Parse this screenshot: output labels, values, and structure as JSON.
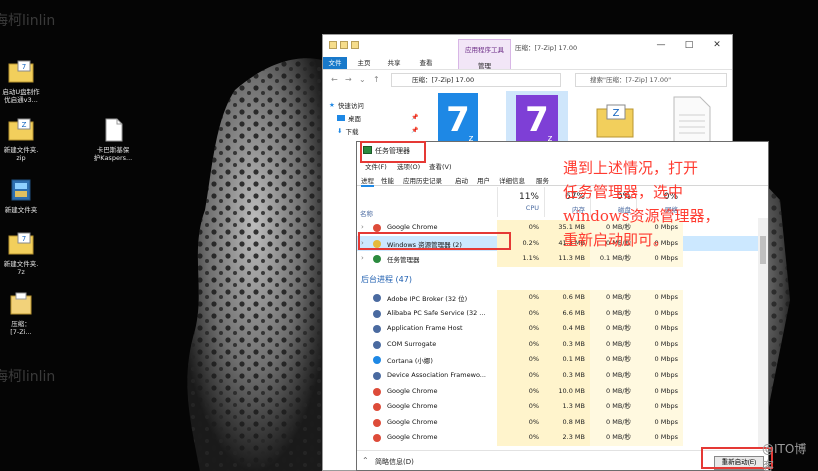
{
  "desktop": {
    "watermarks": [
      "海柯linlin",
      "海柯linlin"
    ],
    "corner_watermark": "@ITO博客",
    "icons": [
      {
        "label": "启动U盘制作\n优启通v3...",
        "icon": "7zip-archive-icon"
      },
      {
        "label": "新建文件夹.\nzip",
        "icon": "zip-archive-icon"
      },
      {
        "label": "卡巴斯基保\n护Kaspers...",
        "icon": "document-icon"
      },
      {
        "label": "新建文件夹",
        "icon": "folder-icon"
      },
      {
        "label": "新建文件夹.\n7z",
        "icon": "7zip-archive-icon"
      },
      {
        "label": "压缩：\n[7-Zi...",
        "icon": "folder-icon"
      }
    ]
  },
  "explorer": {
    "context_tab_top": "应用程序工具",
    "context_tab_bottom": "管理",
    "title": "压缩：[7-Zip] 17.00",
    "ribbon_tabs": [
      "文件",
      "主页",
      "共享",
      "查看"
    ],
    "address": "压缩：[7-Zip] 17.00",
    "search_placeholder": "搜索\"压缩：[7-Zip] 17.00\"",
    "nav_items": [
      "快速访问",
      "桌面",
      "下载"
    ],
    "window_buttons": [
      "—",
      "□",
      "✕"
    ],
    "zip_letter": "Z",
    "seven": "7"
  },
  "taskmgr": {
    "title": "任务管理器",
    "menu": [
      "文件(F)",
      "选项(O)",
      "查看(V)"
    ],
    "tabs": [
      "进程",
      "性能",
      "应用历史记录",
      "启动",
      "用户",
      "详细信息",
      "服务"
    ],
    "columns": [
      {
        "pct": "11%",
        "name": "CPU"
      },
      {
        "pct": "67%",
        "name": "内存"
      },
      {
        "pct": "0%",
        "name": "磁盘"
      },
      {
        "pct": "0%",
        "name": "网络"
      }
    ],
    "name_header": "名称",
    "background_section": "后台进程 (47)",
    "apps": [
      {
        "name": "Google Chrome",
        "cpu": "0%",
        "mem": "35.1 MB",
        "disk": "0 MB/秒",
        "net": "0 Mbps",
        "icon": "chrome-icon"
      },
      {
        "name": "Windows 资源管理器 (2)",
        "cpu": "0.2%",
        "mem": "41.3 MB",
        "disk": "0 MB/秒",
        "net": "0 Mbps",
        "icon": "explorer-icon"
      },
      {
        "name": "任务管理器",
        "cpu": "1.1%",
        "mem": "11.3 MB",
        "disk": "0.1 MB/秒",
        "net": "0 Mbps",
        "icon": "taskmgr-icon"
      }
    ],
    "background": [
      {
        "name": "Adobe IPC Broker (32 位)",
        "cpu": "0%",
        "mem": "0.6 MB",
        "disk": "0 MB/秒",
        "net": "0 Mbps",
        "icon": "app-icon"
      },
      {
        "name": "Alibaba PC Safe Service (32 ...",
        "cpu": "0%",
        "mem": "6.6 MB",
        "disk": "0 MB/秒",
        "net": "0 Mbps",
        "icon": "app-icon"
      },
      {
        "name": "Application Frame Host",
        "cpu": "0%",
        "mem": "0.4 MB",
        "disk": "0 MB/秒",
        "net": "0 Mbps",
        "icon": "app-icon"
      },
      {
        "name": "COM Surrogate",
        "cpu": "0%",
        "mem": "0.3 MB",
        "disk": "0 MB/秒",
        "net": "0 Mbps",
        "icon": "app-icon"
      },
      {
        "name": "Cortana (小娜)",
        "cpu": "0%",
        "mem": "0.1 MB",
        "disk": "0 MB/秒",
        "net": "0 Mbps",
        "icon": "cortana-icon"
      },
      {
        "name": "Device Association Framewo...",
        "cpu": "0%",
        "mem": "0.3 MB",
        "disk": "0 MB/秒",
        "net": "0 Mbps",
        "icon": "app-icon"
      },
      {
        "name": "Google Chrome",
        "cpu": "0%",
        "mem": "10.0 MB",
        "disk": "0 MB/秒",
        "net": "0 Mbps",
        "icon": "chrome-icon"
      },
      {
        "name": "Google Chrome",
        "cpu": "0%",
        "mem": "1.3 MB",
        "disk": "0 MB/秒",
        "net": "0 Mbps",
        "icon": "chrome-icon"
      },
      {
        "name": "Google Chrome",
        "cpu": "0%",
        "mem": "0.8 MB",
        "disk": "0 MB/秒",
        "net": "0 Mbps",
        "icon": "chrome-icon"
      },
      {
        "name": "Google Chrome",
        "cpu": "0%",
        "mem": "2.3 MB",
        "disk": "0 MB/秒",
        "net": "0 Mbps",
        "icon": "chrome-icon"
      }
    ],
    "fewer_details": "简略信息(D)",
    "restart_button": "重新启动(E)"
  },
  "annotation": {
    "lines": [
      "遇到上述情况，打开",
      "任务管理器，选中",
      "windows资源管理器，",
      "重新启动即可。"
    ],
    "color": "#ff3b30"
  }
}
